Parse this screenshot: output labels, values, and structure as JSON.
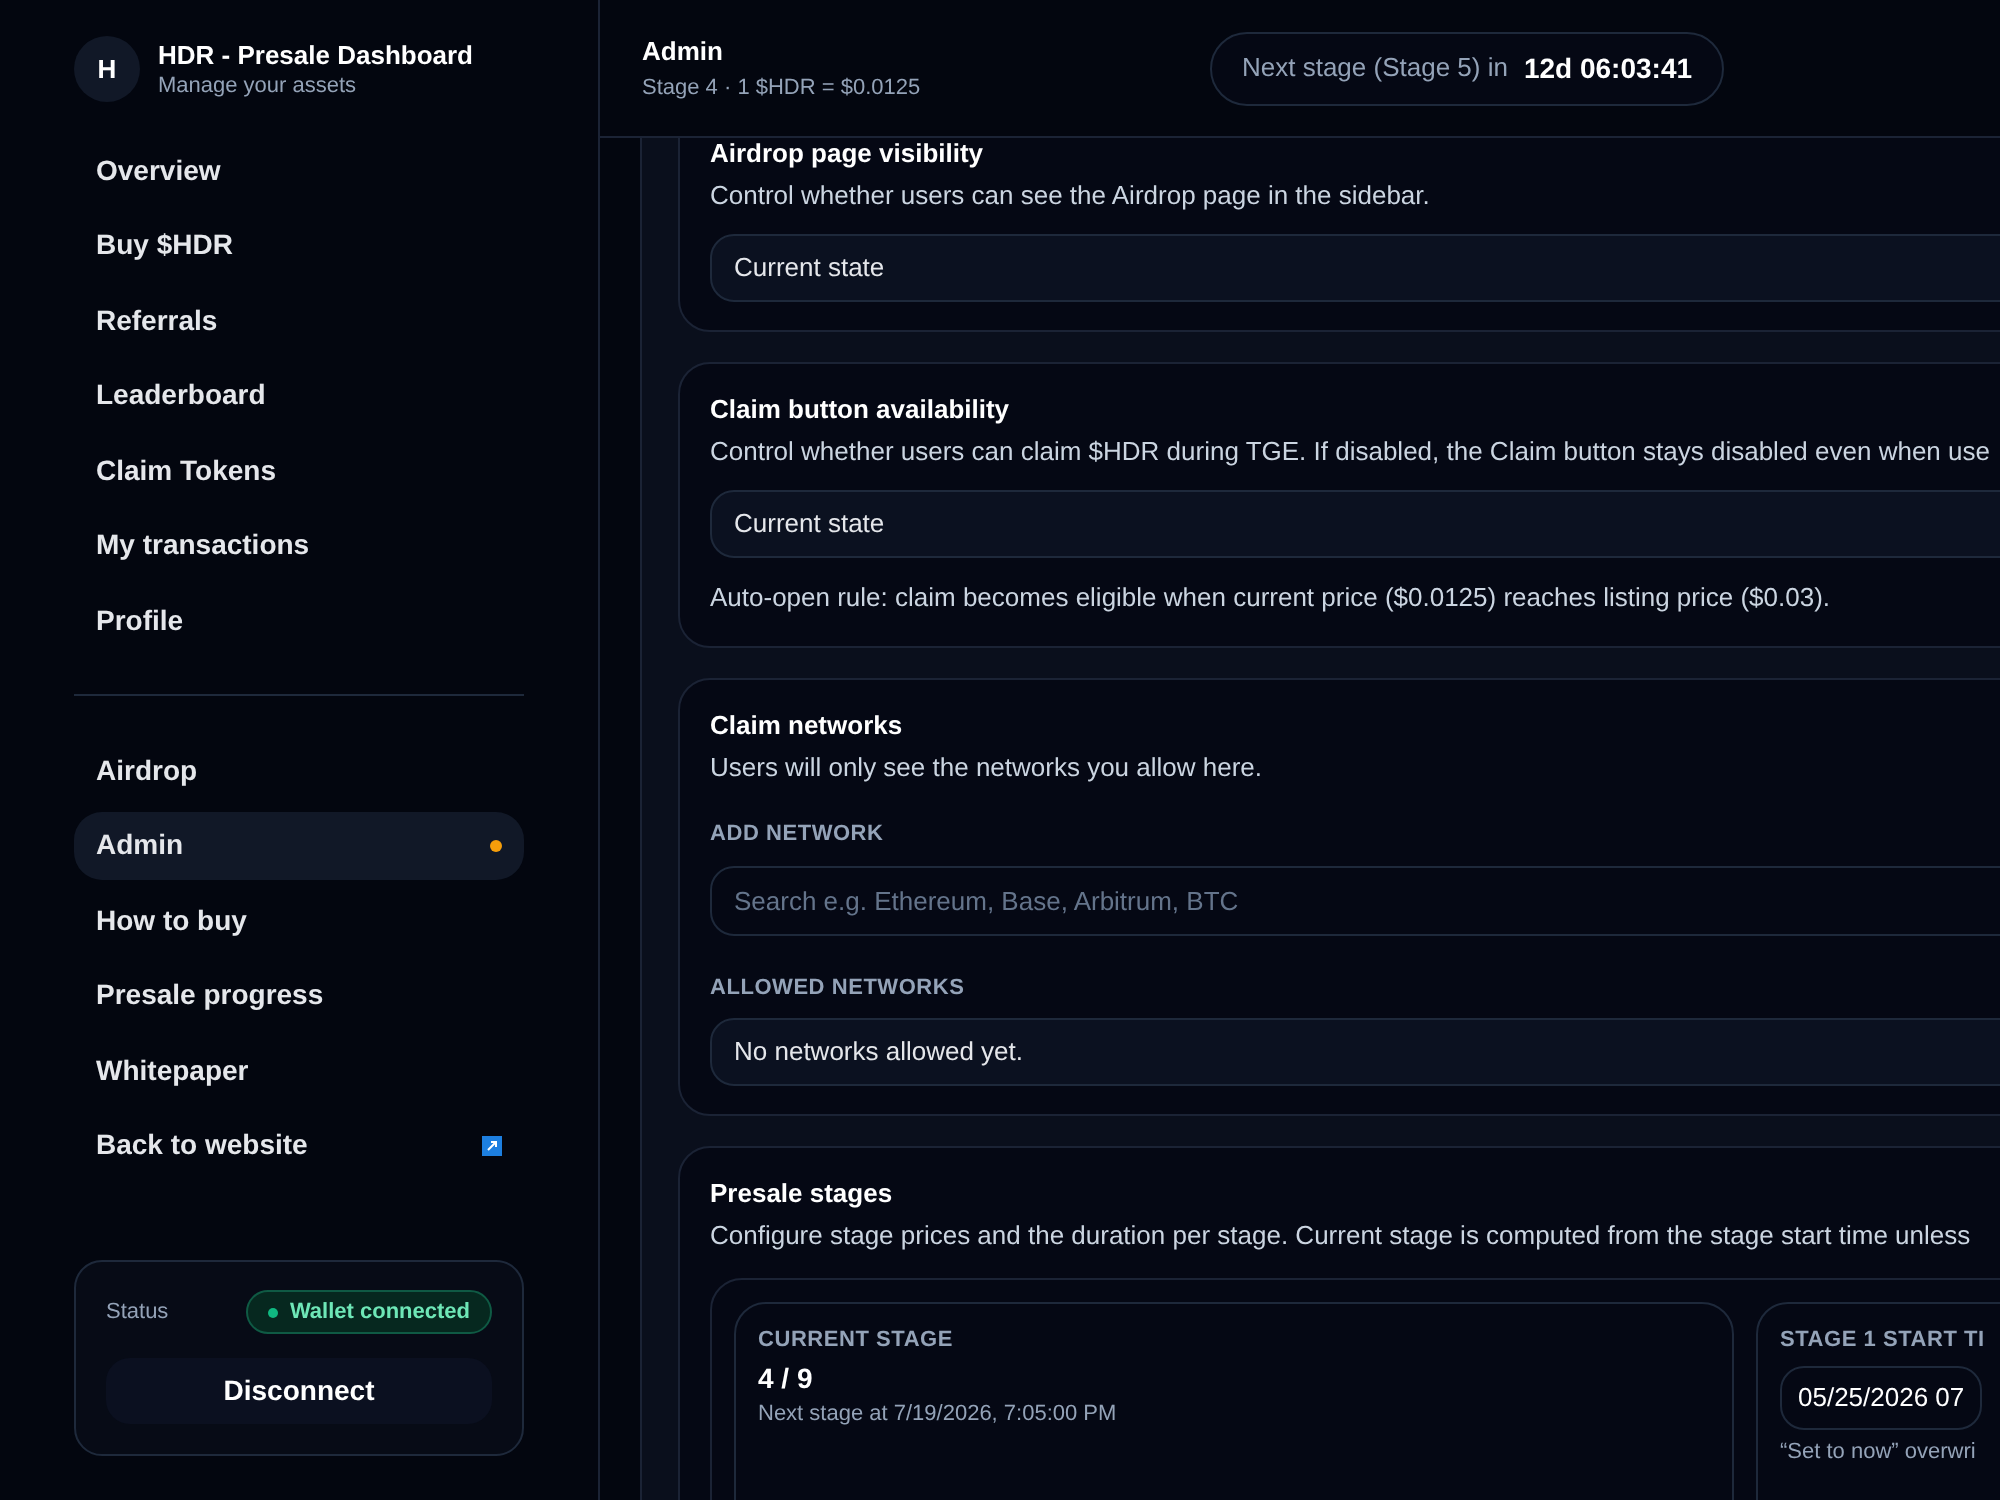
{
  "brand": {
    "initial": "H",
    "title": "HDR - Presale Dashboard",
    "subtitle": "Manage your assets"
  },
  "nav_groups": [
    [
      {
        "label": "Overview",
        "selected": false,
        "notification": false,
        "external": false
      },
      {
        "label": "Buy $HDR",
        "selected": false,
        "notification": false,
        "external": false
      },
      {
        "label": "Referrals",
        "selected": false,
        "notification": false,
        "external": false
      },
      {
        "label": "Leaderboard",
        "selected": false,
        "notification": false,
        "external": false
      },
      {
        "label": "Claim Tokens",
        "selected": false,
        "notification": false,
        "external": false
      },
      {
        "label": "My transactions",
        "selected": false,
        "notification": false,
        "external": false
      },
      {
        "label": "Profile",
        "selected": false,
        "notification": false,
        "external": false
      }
    ],
    [
      {
        "label": "Airdrop",
        "selected": false,
        "notification": false,
        "external": false
      },
      {
        "label": "Admin",
        "selected": true,
        "notification": true,
        "external": false
      },
      {
        "label": "How to buy",
        "selected": false,
        "notification": false,
        "external": false
      },
      {
        "label": "Presale progress",
        "selected": false,
        "notification": false,
        "external": false
      },
      {
        "label": "Whitepaper",
        "selected": false,
        "notification": false,
        "external": false
      },
      {
        "label": "Back to website",
        "selected": false,
        "notification": false,
        "external": true
      }
    ]
  ],
  "status": {
    "label": "Status",
    "badge": "Wallet connected",
    "connected": true,
    "button": "Disconnect"
  },
  "header": {
    "title": "Admin",
    "subtitle": "Stage 4 · 1 $HDR = $0.0125",
    "countdown_label": "Next stage (Stage 5) in",
    "countdown": "12d 06:03:41"
  },
  "cards": [
    {
      "kind": "toggle",
      "title": "Airdrop page visibility",
      "description": "Control whether users can see the Airdrop page in the sidebar.",
      "field": "Current state"
    },
    {
      "kind": "toggle",
      "title": "Claim button availability",
      "description": "Control whether users can claim $HDR during TGE. If disabled, the Claim button stays disabled even when use",
      "field": "Current state",
      "note": "Auto-open rule: claim becomes eligible when current price ($0.0125) reaches listing price ($0.03)."
    },
    {
      "kind": "networks",
      "title": "Claim networks",
      "description": "Users will only see the networks you allow here.",
      "add_label": "ADD NETWORK",
      "placeholder": "Search e.g. Ethereum, Base, Arbitrum, BTC",
      "allowed_label": "ALLOWED NETWORKS",
      "allowed_empty": "No networks allowed yet."
    },
    {
      "kind": "stages",
      "title": "Presale stages",
      "description": "Configure stage prices and the duration per stage. Current stage is computed from the stage start time unless",
      "current_label": "CURRENT STAGE",
      "current_value": "4 / 9",
      "next_text": "Next stage at 7/19/2026, 7:05:00 PM",
      "start_label": "STAGE 1 START TI",
      "start_value": "05/25/2026 07",
      "start_hint": "“Set to now” overwri"
    }
  ]
}
